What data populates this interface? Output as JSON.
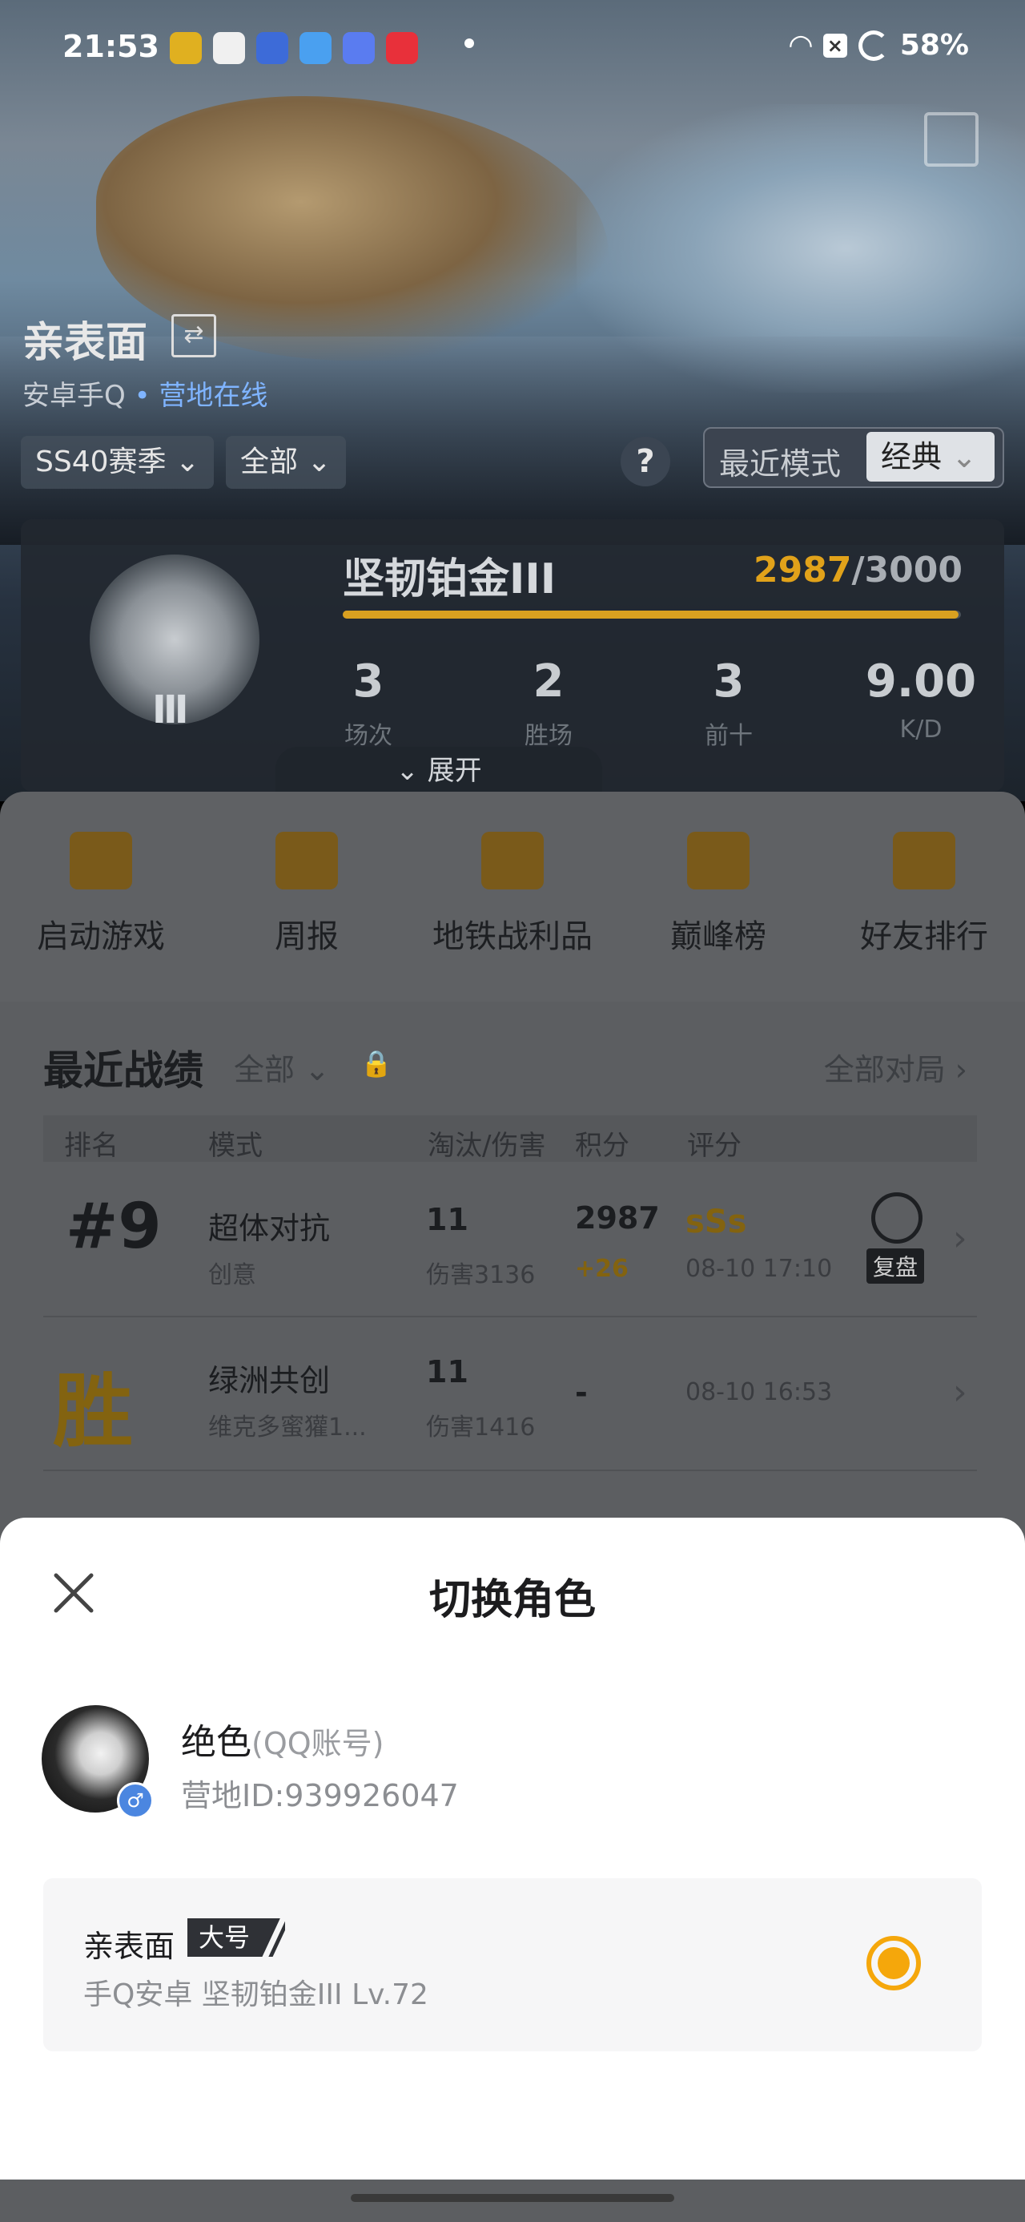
{
  "status_bar": {
    "time": "21:53",
    "battery": "58%"
  },
  "header": {
    "player_name": "亲表面",
    "platform": "安卓手Q",
    "online_status": "营地在线",
    "season": "SS40赛季",
    "scope": "全部",
    "mode_label": "最近模式",
    "mode_value": "经典"
  },
  "rank": {
    "title": "坚韧铂金III",
    "points_current": "2987",
    "points_max": "/3000",
    "progress": 0.9957,
    "badge_tier": "III",
    "stats": [
      {
        "value": "3",
        "label": "场次"
      },
      {
        "value": "2",
        "label": "胜场"
      },
      {
        "value": "3",
        "label": "前十"
      },
      {
        "value": "9.00",
        "label": "K/D"
      }
    ],
    "expand_label": "展开"
  },
  "quick_actions": [
    {
      "label": "启动游戏",
      "icon": "lightning-icon",
      "color": "#b07a10"
    },
    {
      "label": "周报",
      "icon": "calendar-icon",
      "color": "#b07a10"
    },
    {
      "label": "地铁战利品",
      "icon": "metro-badge-icon",
      "color": "#b07a10"
    },
    {
      "label": "巅峰榜",
      "icon": "shield-crown-icon",
      "color": "#b07a10"
    },
    {
      "label": "好友排行",
      "icon": "podium-icon",
      "color": "#b07a10"
    }
  ],
  "records": {
    "title": "最近战绩",
    "filter": "全部",
    "all_matches": "全部对局",
    "columns": [
      "排名",
      "模式",
      "淘汰/伤害",
      "积分",
      "评分"
    ],
    "rows": [
      {
        "rank": "#9",
        "mode": "超体对抗",
        "sub": "创意",
        "kills": "11",
        "damage": "伤害3136",
        "points": "2987",
        "delta": "+26",
        "score": "sSs",
        "time": "08-10 17:10",
        "replay": "复盘"
      },
      {
        "rank": "胜",
        "mode": "绿洲共创",
        "sub": "维克多蜜獾1...",
        "kills": "11",
        "damage": "伤害1416",
        "points": "-",
        "delta": "",
        "score": "",
        "time": "08-10 16:53",
        "replay": ""
      }
    ]
  },
  "sheet": {
    "title": "切换角色",
    "account_name": "绝色",
    "account_type": "(QQ账号)",
    "camp_id": "营地ID:939926047",
    "role": {
      "name": "亲表面",
      "tag": "大号",
      "detail": "手Q安卓  坚韧铂金III  Lv.72",
      "selected": true
    },
    "accent": "#f5a70b"
  }
}
